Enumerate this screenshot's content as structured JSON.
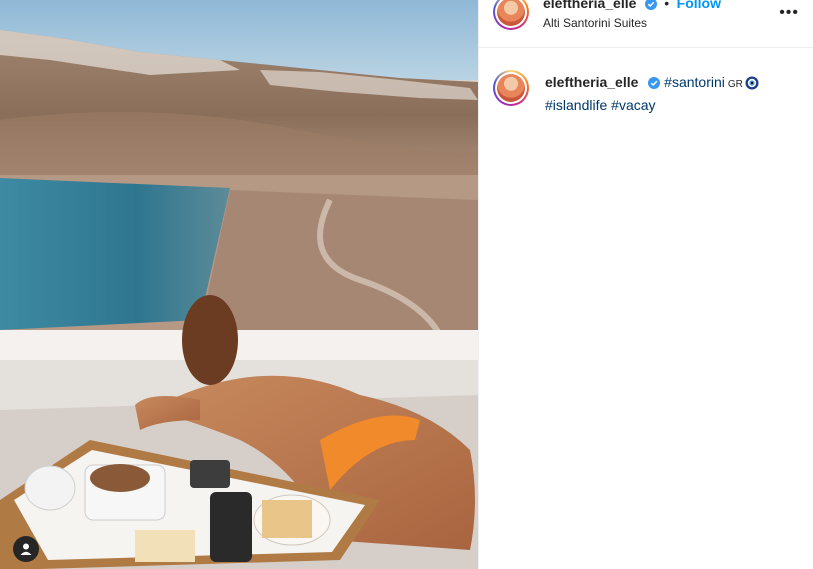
{
  "post": {
    "username": "eleftheria_elle",
    "follow_label": "Follow",
    "separator": "•",
    "location": "Alti Santorini Suites",
    "more_label": "•••"
  },
  "caption": {
    "username": "eleftheria_elle",
    "hashtags": [
      "#santorini",
      "#islandlife",
      "#vacay"
    ],
    "flag_text": "GR"
  },
  "colors": {
    "link_blue": "#0095f6",
    "hashtag_blue": "#00376b",
    "verified_blue": "#3897f0",
    "text_dark": "#262626"
  },
  "icons": {
    "verified": "verified-badge-icon",
    "more": "more-options-icon",
    "user_tag": "person-icon",
    "nazar": "nazar-eye-icon"
  }
}
